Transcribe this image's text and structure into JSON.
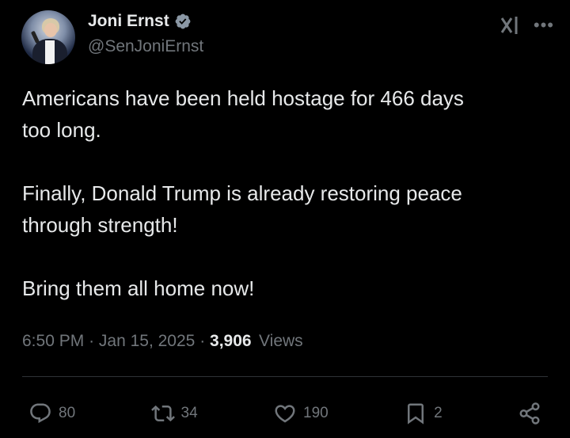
{
  "author": {
    "display_name": "Joni Ernst",
    "handle": "@SenJoniErnst",
    "verified": true
  },
  "tweet": {
    "text": "Americans have been held hostage for 466 days\ntoo long.\n\nFinally, Donald Trump is already restoring peace\nthrough strength!\n\nBring them all home now!",
    "time": "6:50 PM",
    "date": "Jan 15, 2025",
    "separator": "·",
    "views_count": "3,906",
    "views_label": "Views"
  },
  "actions": {
    "replies": "80",
    "reposts": "34",
    "likes": "190",
    "bookmarks": "2"
  },
  "icons": {
    "verified": "verified-badge-icon",
    "grok": "grok-icon",
    "more": "more-icon",
    "reply": "reply-icon",
    "repost": "repost-icon",
    "like": "like-icon",
    "bookmark": "bookmark-icon",
    "share": "share-icon"
  },
  "colors": {
    "background": "#000000",
    "text": "#e7e9ea",
    "muted": "#71767b",
    "verified": "#8b98a5"
  }
}
